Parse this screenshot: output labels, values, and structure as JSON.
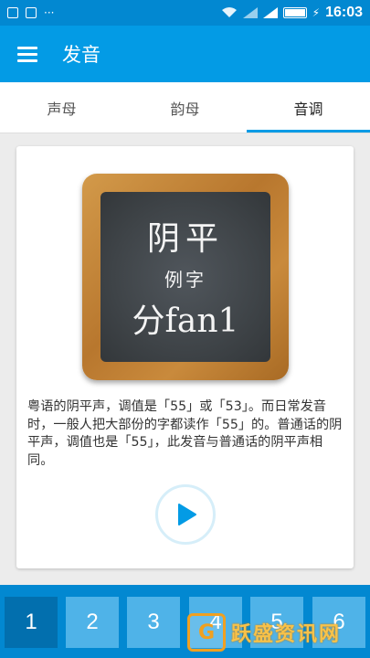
{
  "status_bar": {
    "time": "16:03",
    "dots": "···"
  },
  "app_bar": {
    "title": "发音"
  },
  "tabs": [
    {
      "label": "声母",
      "active": false
    },
    {
      "label": "韵母",
      "active": false
    },
    {
      "label": "音调",
      "active": true
    }
  ],
  "card": {
    "board": {
      "tone": "阴平",
      "example_label": "例字",
      "example": "分fan1"
    },
    "description": "粤语的阴平声，调值是「55」或「53」。而日常发音时，一般人把大部份的字都读作「55」的。普通话的阴平声，调值也是「55」，此发音与普通话的阴平声相同。",
    "play_icon": "play-icon"
  },
  "numbers": [
    "1",
    "2",
    "3",
    "4",
    "5",
    "6"
  ],
  "active_number": "1",
  "watermark": {
    "text": "跃盛资讯网"
  },
  "colors": {
    "primary": "#039be5",
    "status": "#0288d1",
    "active_num": "#026fae",
    "num": "#4fb3e8"
  }
}
